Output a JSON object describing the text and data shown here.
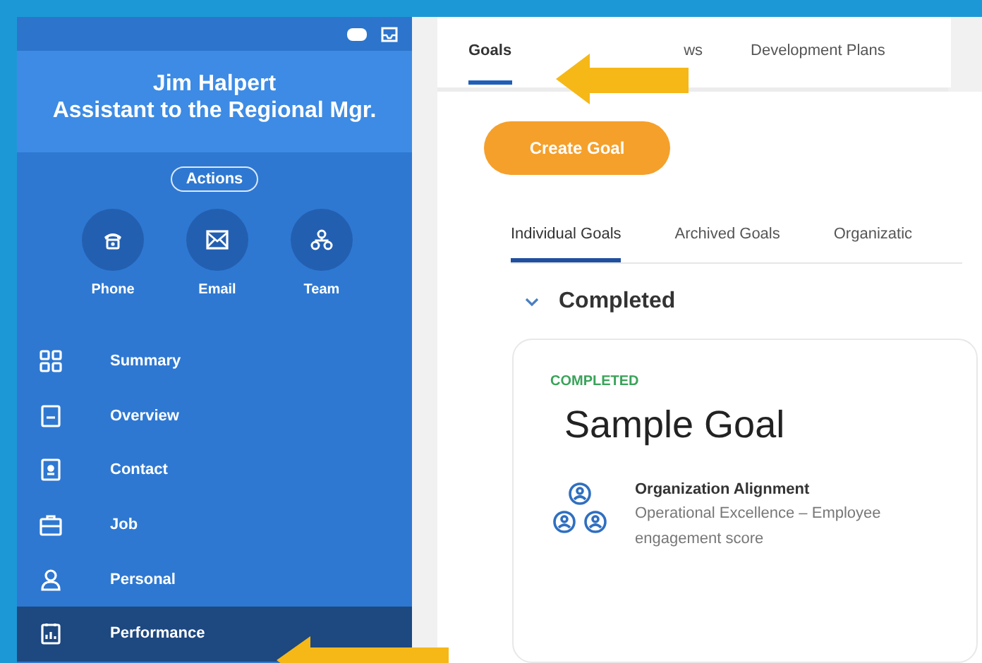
{
  "profile": {
    "name": "Jim Halpert",
    "title": "Assistant to the Regional Mgr.",
    "actions_button": "Actions"
  },
  "contact_buttons": [
    {
      "kind": "phone",
      "label": "Phone"
    },
    {
      "kind": "email",
      "label": "Email"
    },
    {
      "kind": "team",
      "label": "Team"
    }
  ],
  "sidebar": {
    "items": [
      {
        "kind": "summary",
        "label": "Summary",
        "selected": false
      },
      {
        "kind": "overview",
        "label": "Overview",
        "selected": false
      },
      {
        "kind": "contact",
        "label": "Contact",
        "selected": false
      },
      {
        "kind": "job",
        "label": "Job",
        "selected": false
      },
      {
        "kind": "personal",
        "label": "Personal",
        "selected": false
      },
      {
        "kind": "performance",
        "label": "Performance",
        "selected": true
      }
    ]
  },
  "tabs": [
    {
      "label": "Goals",
      "selected": true
    },
    {
      "label": "ws",
      "selected": false
    },
    {
      "label": "Development Plans",
      "selected": false
    }
  ],
  "create_button": "Create Goal",
  "subtabs": [
    {
      "label": "Individual Goals",
      "selected": true
    },
    {
      "label": "Archived Goals",
      "selected": false
    },
    {
      "label": "Organizatic",
      "selected": false
    }
  ],
  "section": {
    "title": "Completed",
    "expanded": true
  },
  "goal": {
    "status": "COMPLETED",
    "title": "Sample Goal",
    "alignment_label": "Organization Alignment",
    "alignment_value": "Operational Excellence – Employee engagement score"
  }
}
